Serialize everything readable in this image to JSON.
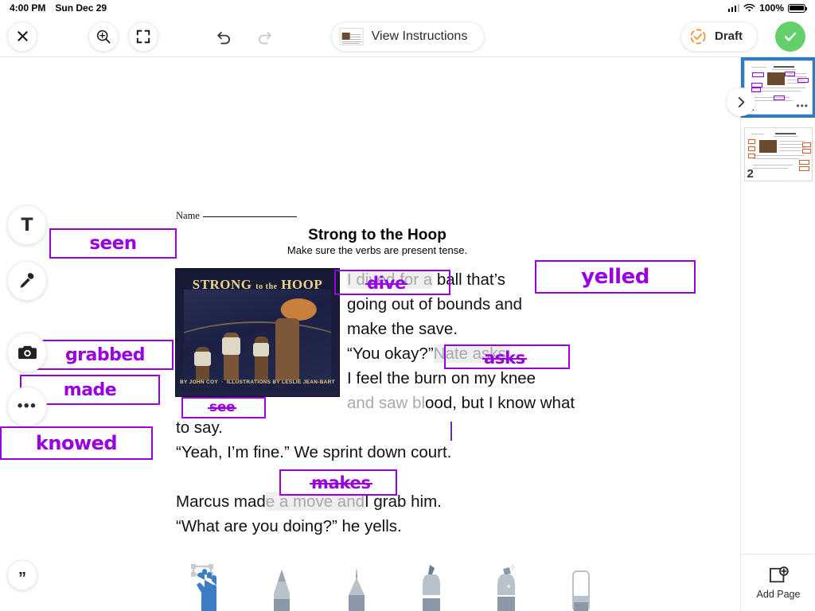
{
  "status_bar": {
    "time": "4:00 PM",
    "date": "Sun Dec 29",
    "battery": "100%",
    "wifi_icon": "wifi-icon",
    "signal_icon": "cellular-signal-icon"
  },
  "toolbar": {
    "close_icon": "close-icon",
    "zoom_icon": "zoom-in-icon",
    "fit_icon": "fit-to-screen-icon",
    "undo_icon": "undo-icon",
    "redo_icon": "redo-icon",
    "instructions_label": "View Instructions",
    "status_label": "Draft",
    "status_color": "#f5911e",
    "done_icon": "checkmark-icon",
    "done_color": "#63d06a"
  },
  "worksheet": {
    "name_label": "Name",
    "title": "Strong to the Hoop",
    "subtitle": "Make sure the verbs are present tense.",
    "book_cover": {
      "title_main": "STRONG",
      "title_small": "to the",
      "title_end": "HOOP",
      "credits_by": "BY JOHN COY",
      "credits_illus": "ILLUSTRATIONS BY LESLIE JEAN-BART"
    },
    "paragraph_1": {
      "struck_1": "I dived for a",
      "overlay_1": "dive",
      "rest_1": "ball that’s",
      "line_2": "going out of bounds and",
      "line_3": "make the save.",
      "quote_1": "“You okay?”",
      "struck_2": "Nate asks.",
      "overlay_2": "asks",
      "line_5": "I feel the burn on my knee",
      "struck_3": "and saw bl",
      "overlay_3": "see",
      "rest_3": "ood, but I know what to say.",
      "line_7": "“Yeah, I’m fine.”  We sprint down court."
    },
    "paragraph_2": {
      "pre": "Marcus mad",
      "struck": "e a move and",
      "overlay": "makes",
      "post": "I grab him.",
      "line_2": "“What are you doing?” he yells."
    }
  },
  "annotations": {
    "ink_color": "#9900e0",
    "labels": [
      {
        "text": "seen",
        "name": "annotation-seen"
      },
      {
        "text": "yelled",
        "name": "annotation-yelled"
      },
      {
        "text": "grabbed",
        "name": "annotation-grabbed"
      },
      {
        "text": "made",
        "name": "annotation-made"
      },
      {
        "text": "knowed",
        "name": "annotation-knowed"
      }
    ]
  },
  "tool_rail": [
    {
      "icon": "text-tool-icon",
      "glyph": "T"
    },
    {
      "icon": "microphone-icon",
      "glyph": ""
    },
    {
      "icon": "camera-icon",
      "glyph": ""
    },
    {
      "icon": "more-options-icon",
      "glyph": "•••"
    }
  ],
  "quote_tool": {
    "icon": "quote-icon",
    "glyph": "”"
  },
  "pen_tray": {
    "selected": "selection-hand",
    "items": [
      {
        "name": "selection-hand-tool",
        "label": "selection"
      },
      {
        "name": "pencil-tool",
        "label": "pencil"
      },
      {
        "name": "thin-pen-tool",
        "label": "thin pen"
      },
      {
        "name": "marker-tool",
        "label": "marker"
      },
      {
        "name": "glitter-pen-tool",
        "label": "glitter pen"
      },
      {
        "name": "eraser-tool",
        "label": "eraser"
      }
    ]
  },
  "pages_panel": {
    "collapse_icon": "chevron-right-icon",
    "add_page_label": "Add Page",
    "add_page_icon": "add-page-icon",
    "pages": [
      {
        "number": "1",
        "selected": true,
        "more_icon": "page-more-icon"
      },
      {
        "number": "2",
        "selected": false,
        "more_icon": "page-more-icon"
      }
    ]
  }
}
